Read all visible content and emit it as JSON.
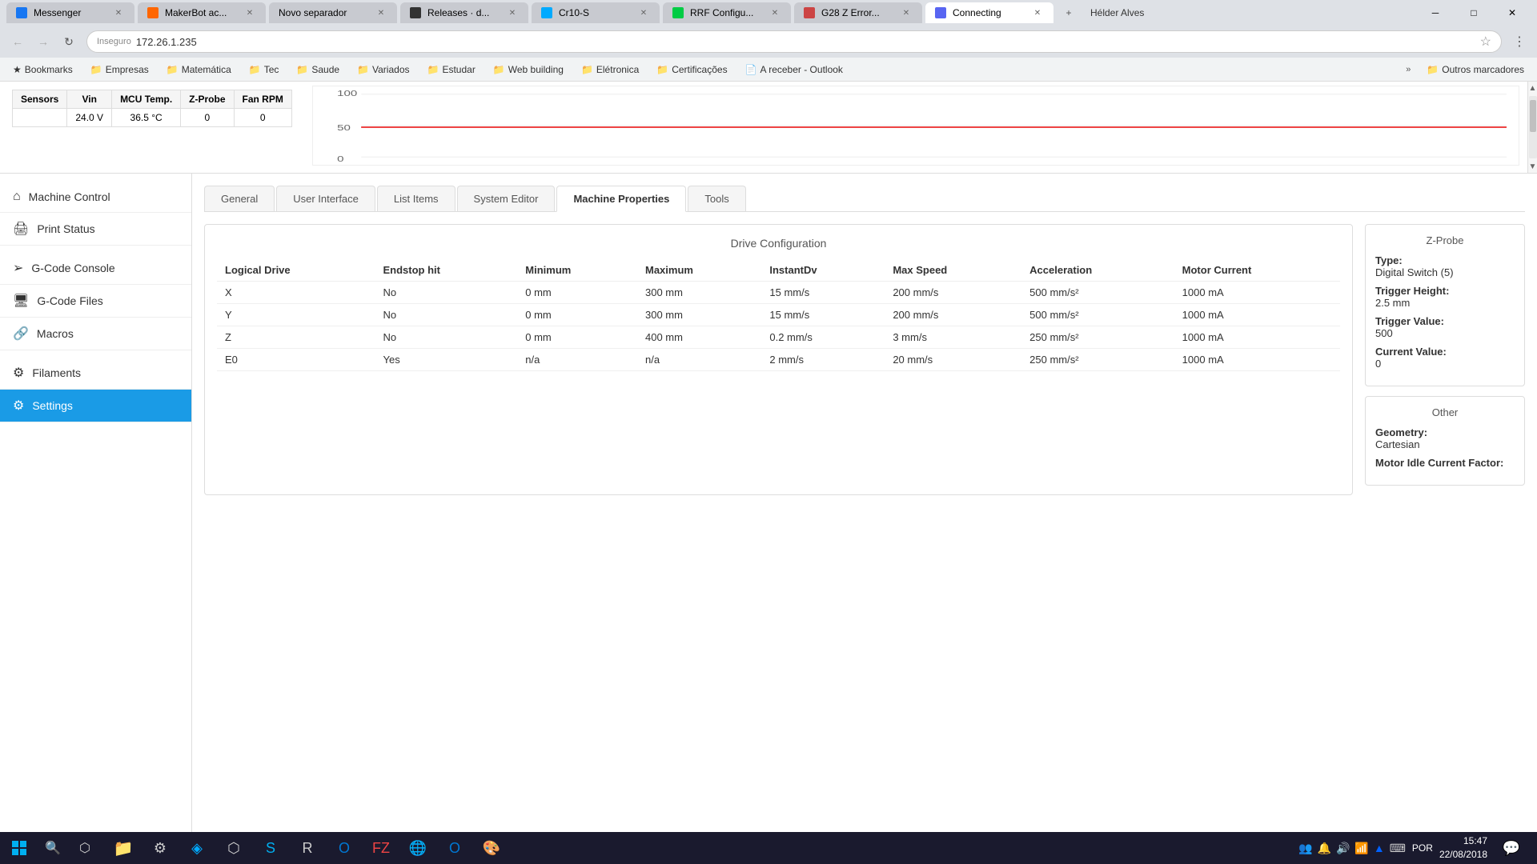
{
  "browser": {
    "tabs": [
      {
        "id": "messenger",
        "label": "Messenger",
        "color": "fb-color",
        "active": false,
        "favicon": "f"
      },
      {
        "id": "makerbot",
        "label": "MakerBot ac...",
        "color": "mb-color",
        "active": false,
        "favicon": "m"
      },
      {
        "id": "novo",
        "label": "Novo separador",
        "color": "nt-color",
        "active": false,
        "favicon": "+"
      },
      {
        "id": "releases",
        "label": "Releases · d...",
        "color": "gh-color",
        "active": false,
        "favicon": "g"
      },
      {
        "id": "cr10",
        "label": "Cr10-S",
        "color": "cr10-color",
        "active": false,
        "favicon": "c"
      },
      {
        "id": "rrf",
        "label": "RRF Configu...",
        "color": "rrf-color",
        "active": false,
        "favicon": "r"
      },
      {
        "id": "g28",
        "label": "G28 Z Error...",
        "color": "g28-color",
        "active": false,
        "favicon": "g"
      },
      {
        "id": "connecting",
        "label": "Connecting",
        "color": "dc-color",
        "active": true,
        "favicon": "d"
      }
    ],
    "url": {
      "protocol": "Inseguro",
      "address": "172.26.1.235"
    },
    "user": "Hélder Alves",
    "bookmarks": [
      {
        "label": "Bookmarks",
        "icon": "★"
      },
      {
        "label": "Empresas",
        "icon": "📁"
      },
      {
        "label": "Matemática",
        "icon": "📁"
      },
      {
        "label": "Tec",
        "icon": "📁"
      },
      {
        "label": "Saude",
        "icon": "📁"
      },
      {
        "label": "Variados",
        "icon": "📁"
      },
      {
        "label": "Estudar",
        "icon": "📁"
      },
      {
        "label": "Web building",
        "icon": "📁"
      },
      {
        "label": "Elétronica",
        "icon": "📁"
      },
      {
        "label": "Certificações",
        "icon": "📁"
      },
      {
        "label": "A receber - Outlook",
        "icon": "📄"
      }
    ],
    "bookmarks_more": "»",
    "bookmarks_other": "Outros marcadores"
  },
  "sensors": {
    "title": "Sensors",
    "headers": [
      "Vin",
      "MCU Temp.",
      "Z-Probe",
      "Fan RPM"
    ],
    "values": [
      "24.0 V",
      "36.5 °C",
      "0",
      "0"
    ]
  },
  "sidebar": {
    "items": [
      {
        "id": "machine-control",
        "label": "Machine Control",
        "icon": "⌂"
      },
      {
        "id": "print-status",
        "label": "Print Status",
        "icon": "🖨"
      },
      {
        "id": "gcode-console",
        "label": "G-Code Console",
        "icon": ">"
      },
      {
        "id": "gcode-files",
        "label": "G-Code Files",
        "icon": "💾"
      },
      {
        "id": "macros",
        "label": "Macros",
        "icon": "🔗"
      },
      {
        "id": "filaments",
        "label": "Filaments",
        "icon": "⚙"
      },
      {
        "id": "settings",
        "label": "Settings",
        "icon": "⚙",
        "active": true
      }
    ]
  },
  "tabs": {
    "items": [
      {
        "id": "general",
        "label": "General"
      },
      {
        "id": "user-interface",
        "label": "User Interface"
      },
      {
        "id": "list-items",
        "label": "List Items"
      },
      {
        "id": "system-editor",
        "label": "System Editor"
      },
      {
        "id": "machine-properties",
        "label": "Machine Properties",
        "active": true
      },
      {
        "id": "tools",
        "label": "Tools"
      }
    ]
  },
  "drive_config": {
    "title": "Drive Configuration",
    "headers": [
      "Logical Drive",
      "Endstop hit",
      "Minimum",
      "Maximum",
      "InstantDv",
      "Max Speed",
      "Acceleration",
      "Motor Current"
    ],
    "rows": [
      {
        "drive": "X",
        "endstop": "No",
        "min": "0 mm",
        "max": "300 mm",
        "instantdv": "15 mm/s",
        "maxspeed": "200 mm/s",
        "accel": "500 mm/s²",
        "motor": "1000 mA"
      },
      {
        "drive": "Y",
        "endstop": "No",
        "min": "0 mm",
        "max": "300 mm",
        "instantdv": "15 mm/s",
        "maxspeed": "200 mm/s",
        "accel": "500 mm/s²",
        "motor": "1000 mA"
      },
      {
        "drive": "Z",
        "endstop": "No",
        "min": "0 mm",
        "max": "400 mm",
        "instantdv": "0.2 mm/s",
        "maxspeed": "3 mm/s",
        "accel": "250 mm/s²",
        "motor": "1000 mA"
      },
      {
        "drive": "E0",
        "endstop": "Yes",
        "min": "n/a",
        "max": "n/a",
        "instantdv": "2 mm/s",
        "maxspeed": "20 mm/s",
        "accel": "250 mm/s²",
        "motor": "1000 mA"
      }
    ]
  },
  "zprobe": {
    "title": "Z-Probe",
    "type_label": "Type:",
    "type_value": "Digital Switch (5)",
    "trigger_height_label": "Trigger Height:",
    "trigger_height_value": "2.5 mm",
    "trigger_value_label": "Trigger Value:",
    "trigger_value_value": "500",
    "current_value_label": "Current Value:",
    "current_value_value": "0"
  },
  "other": {
    "title": "Other",
    "geometry_label": "Geometry:",
    "geometry_value": "Cartesian",
    "motor_idle_label": "Motor Idle Current Factor:"
  },
  "taskbar": {
    "time": "15:47",
    "date": "22/08/2018",
    "lang": "POR"
  }
}
